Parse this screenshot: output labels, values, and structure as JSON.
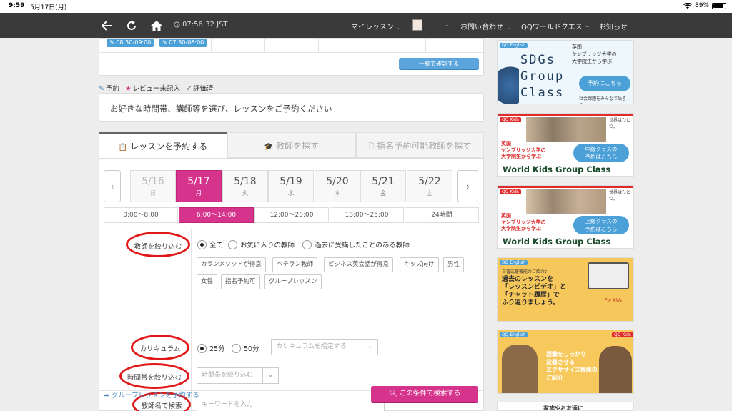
{
  "status_bar": {
    "time": "9:59",
    "date": "5月17日(月)",
    "battery": "89%",
    "battery_level": 0.89
  },
  "nav": {
    "clock": "07:56:32 JST",
    "my_lesson": "マイレッスン",
    "contact": "お問い合わせ",
    "quest": "QQワールドクエスト",
    "news": "お知らせ"
  },
  "top_card": {
    "slots": [
      "08:30-09:00",
      "07:30-08:00"
    ],
    "list_button": "一覧で確認する"
  },
  "legend": {
    "reserve": "予約",
    "review": "レビュー未記入",
    "rated": "評価済"
  },
  "intro_text": "お好きな時間帯、講師等を選び、レッスンをご予約ください",
  "tabs": [
    "レッスンを予約する",
    "教師を探す",
    "指名予約可能教師を探す"
  ],
  "days": [
    {
      "date": "5/16",
      "weekday": "日"
    },
    {
      "date": "5/17",
      "weekday": "月"
    },
    {
      "date": "5/18",
      "weekday": "火"
    },
    {
      "date": "5/19",
      "weekday": "水"
    },
    {
      "date": "5/20",
      "weekday": "木"
    },
    {
      "date": "5/21",
      "weekday": "金"
    },
    {
      "date": "5/22",
      "weekday": "土"
    }
  ],
  "time_bands": [
    "0:00〜8:00",
    "6:00〜14:00",
    "12:00〜20:00",
    "18:00〜25:00",
    "24時間"
  ],
  "filters": {
    "teacher_label": "教師を絞り込む",
    "teacher_options": [
      "全て",
      "お気に入りの教師",
      "過去に受講したことのある教師"
    ],
    "chips": [
      "カランメソッドが得意",
      "ベテラン教師",
      "ビジネス英会話が得意",
      "キッズ向け",
      "男性",
      "女性",
      "指名予約可",
      "グループレッスン"
    ],
    "curriculum_label": "カリキュラム",
    "durations": [
      "25分",
      "50分"
    ],
    "curriculum_placeholder": "カリキュラムを指定する",
    "timezone_label": "時間帯を絞り込む",
    "timezone_placeholder": "時間帯を絞り込む",
    "name_label": "教師名で検索",
    "keyword_placeholder": "キーワードを入力"
  },
  "group_link": "グループレッスンを予約する",
  "search_button": "この条件で検索する",
  "banners": {
    "sdgs": {
      "brand": "QQ English",
      "line1": "英国",
      "line2": "ケンブリッジ大学の",
      "line3": "大学院生から学ぶ",
      "title1": "SDGs",
      "title2": "Group",
      "title3": "Class",
      "cta": "予約はこちら",
      "note": "社会課題をみんなで語ろう。"
    },
    "kids1": {
      "brand": "QQ Kids",
      "tag": "世界はひとつ。",
      "line1": "英国",
      "line2": "ケンブリッジ大学の",
      "line3": "大学院生から学ぶ",
      "cta1": "中級クラスの",
      "cta2": "予約はこちら",
      "title": "World Kids Group Class"
    },
    "kids2": {
      "brand": "QQ Kids",
      "tag": "世界はひとつ。",
      "line1": "英国",
      "line2": "ケンブリッジ大学の",
      "line3": "大学院生から学ぶ",
      "cta1": "上級クラスの",
      "cta2": "予約はこちら",
      "title": "World Kids Group Class"
    },
    "video": {
      "brand": "QQ English",
      "intro": "自習応援機能のご紹介♪",
      "line1": "過去のレッスンを",
      "line2": "「レッスンビデオ」と",
      "line3": "「チャット履歴」で",
      "line4": "ふり返りましょう。",
      "tag": "For Kids"
    },
    "exercise": {
      "brand": "QQ English",
      "brand2": "QQ Kids",
      "line1": "語彙をしっかり",
      "line2": "定着させる",
      "line3": "エクササイズ機能の",
      "line4": "ご紹介"
    },
    "bottom": {
      "text": "家族やお友達に"
    }
  },
  "colors": {
    "accent": "#d6338c",
    "blue": "#5ba5dc",
    "nav": "#3a3a3a",
    "ring": "#e01818"
  }
}
